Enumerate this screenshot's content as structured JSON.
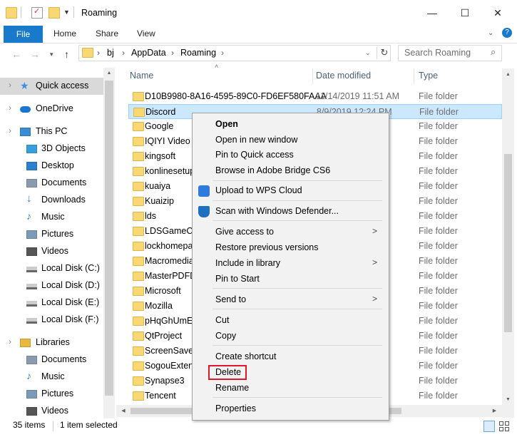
{
  "window": {
    "title": "Roaming",
    "minimize": "—",
    "maximize": "☐",
    "close": "✕"
  },
  "ribbon": {
    "tabs": [
      "File",
      "Home",
      "Share",
      "View"
    ],
    "help": "?"
  },
  "address": {
    "crumbs": [
      "bj",
      "AppData",
      "Roaming"
    ],
    "search_placeholder": "Search Roaming"
  },
  "nav": {
    "items": [
      {
        "label": "Quick access",
        "icon": "star-icon",
        "level": 0,
        "selected": true
      },
      {
        "label": "OneDrive",
        "icon": "cloud-icon",
        "level": 0
      },
      {
        "label": "This PC",
        "icon": "computer-icon",
        "level": 0
      },
      {
        "label": "3D Objects",
        "icon": "cube-icon",
        "level": 1
      },
      {
        "label": "Desktop",
        "icon": "desktop-icon",
        "level": 1
      },
      {
        "label": "Documents",
        "icon": "documents-icon",
        "level": 1
      },
      {
        "label": "Downloads",
        "icon": "download-icon",
        "level": 1
      },
      {
        "label": "Music",
        "icon": "music-icon",
        "level": 1
      },
      {
        "label": "Pictures",
        "icon": "pictures-icon",
        "level": 1
      },
      {
        "label": "Videos",
        "icon": "videos-icon",
        "level": 1
      },
      {
        "label": "Local Disk (C:)",
        "icon": "drive-icon",
        "level": 1
      },
      {
        "label": "Local Disk (D:)",
        "icon": "drive-icon",
        "level": 1
      },
      {
        "label": "Local Disk  (E:)",
        "icon": "drive-icon",
        "level": 1
      },
      {
        "label": "Local Disk (F:)",
        "icon": "drive-icon",
        "level": 1
      },
      {
        "label": "Libraries",
        "icon": "libraries-icon",
        "level": 0
      },
      {
        "label": "Documents",
        "icon": "documents-icon",
        "level": 1
      },
      {
        "label": "Music",
        "icon": "music-icon",
        "level": 1
      },
      {
        "label": "Pictures",
        "icon": "pictures-icon",
        "level": 1
      },
      {
        "label": "Videos",
        "icon": "videos-icon",
        "level": 1
      }
    ]
  },
  "list": {
    "columns": {
      "name": "Name",
      "date": "Date modified",
      "type": "Type"
    },
    "rows": [
      {
        "name": "D10B9980-8A16-4595-89C0-FD6EF580FAAA",
        "date": "11/14/2019 11:51 AM",
        "type": "File folder"
      },
      {
        "name": "Discord",
        "date": "8/9/2019 12:24 PM",
        "type": "File folder",
        "selected": true
      },
      {
        "name": "Google",
        "date": "",
        "type": "File folder"
      },
      {
        "name": "IQIYI Video",
        "date": "",
        "type": "File folder"
      },
      {
        "name": "kingsoft",
        "date": "",
        "type": "File folder"
      },
      {
        "name": "konlinesetup",
        "date": "",
        "type": "File folder"
      },
      {
        "name": "kuaiya",
        "date": "",
        "type": "File folder"
      },
      {
        "name": "Kuaizip",
        "date": "",
        "type": "File folder"
      },
      {
        "name": "lds",
        "date": "",
        "type": "File folder"
      },
      {
        "name": "LDSGameCe",
        "date": "",
        "type": "File folder"
      },
      {
        "name": "lockhomepa",
        "date": "",
        "type": "File folder"
      },
      {
        "name": "Macromedia",
        "date": "",
        "type": "File folder"
      },
      {
        "name": "MasterPDFD",
        "date": "",
        "type": "File folder"
      },
      {
        "name": "Microsoft",
        "date": "",
        "type": "File folder"
      },
      {
        "name": "Mozilla",
        "date": "",
        "type": "File folder"
      },
      {
        "name": "pHqGhUmE",
        "date": "",
        "type": "File folder"
      },
      {
        "name": "QtProject",
        "date": "",
        "type": "File folder"
      },
      {
        "name": "ScreenSaver",
        "date": "",
        "type": "File folder"
      },
      {
        "name": "SogouExten",
        "date": "",
        "type": "File folder"
      },
      {
        "name": "Synapse3",
        "date": "",
        "type": "File folder"
      },
      {
        "name": "Tencent",
        "date": "",
        "type": "File folder"
      }
    ]
  },
  "status": {
    "count": "35 items",
    "selection": "1 item selected"
  },
  "context_menu": {
    "groups": [
      [
        {
          "label": "Open",
          "bold": true
        },
        {
          "label": "Open in new window"
        },
        {
          "label": "Pin to Quick access"
        },
        {
          "label": "Browse in Adobe Bridge CS6"
        }
      ],
      [
        {
          "label": "Upload to WPS Cloud",
          "icon": "wps-cloud-icon"
        }
      ],
      [
        {
          "label": "Scan with Windows Defender...",
          "icon": "defender-shield-icon"
        }
      ],
      [
        {
          "label": "Give access to",
          "submenu": true
        },
        {
          "label": "Restore previous versions"
        },
        {
          "label": "Include in library",
          "submenu": true
        },
        {
          "label": "Pin to Start"
        }
      ],
      [
        {
          "label": "Send to",
          "submenu": true
        }
      ],
      [
        {
          "label": "Cut"
        },
        {
          "label": "Copy"
        }
      ],
      [
        {
          "label": "Create shortcut"
        },
        {
          "label": "Delete",
          "highlighted": true
        },
        {
          "label": "Rename"
        }
      ],
      [
        {
          "label": "Properties"
        }
      ]
    ],
    "submenu_arrow": ">"
  },
  "colors": {
    "accent": "#1979ca",
    "selection": "#cce8ff",
    "highlight_border": "#e0182c",
    "folder": "#f8d775"
  }
}
